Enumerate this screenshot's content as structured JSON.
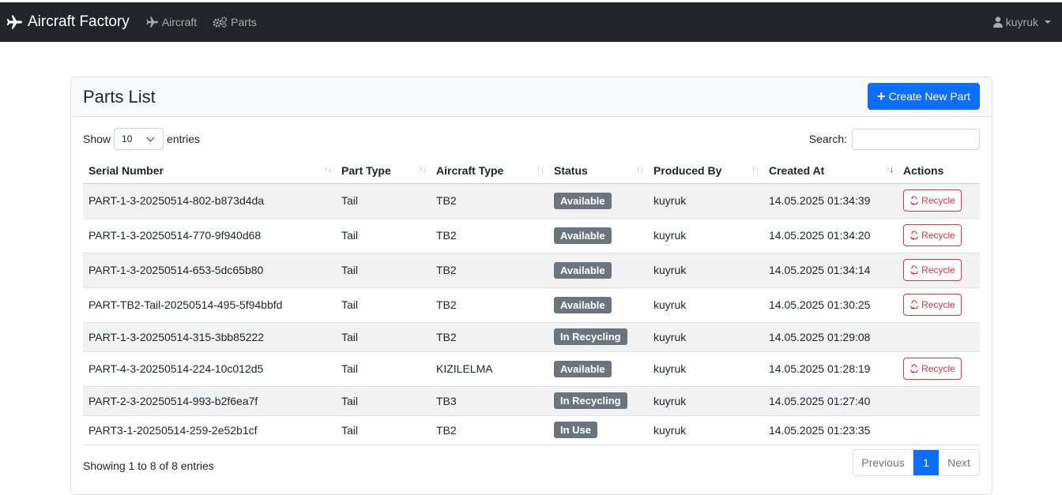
{
  "navbar": {
    "brand": "Aircraft Factory",
    "links": [
      {
        "label": "Aircraft",
        "icon": "plane-icon"
      },
      {
        "label": "Parts",
        "icon": "cogs-icon"
      }
    ],
    "user": "kuyruk"
  },
  "card": {
    "title": "Parts List",
    "create_button": "Create New Part"
  },
  "controls": {
    "show_label": "Show",
    "entries_value": "10",
    "entries_label": "entries",
    "search_label": "Search:",
    "search_value": ""
  },
  "table": {
    "columns": [
      "Serial Number",
      "Part Type",
      "Aircraft Type",
      "Status",
      "Produced By",
      "Created At",
      "Actions"
    ],
    "recycle_label": "Recycle",
    "rows": [
      {
        "serial": "PART-1-3-20250514-802-b873d4da",
        "part_type": "Tail",
        "aircraft": "TB2",
        "status": "Available",
        "by": "kuyruk",
        "created": "14.05.2025 01:34:39",
        "action": true
      },
      {
        "serial": "PART-1-3-20250514-770-9f940d68",
        "part_type": "Tail",
        "aircraft": "TB2",
        "status": "Available",
        "by": "kuyruk",
        "created": "14.05.2025 01:34:20",
        "action": true
      },
      {
        "serial": "PART-1-3-20250514-653-5dc65b80",
        "part_type": "Tail",
        "aircraft": "TB2",
        "status": "Available",
        "by": "kuyruk",
        "created": "14.05.2025 01:34:14",
        "action": true
      },
      {
        "serial": "PART-TB2-Tail-20250514-495-5f94bbfd",
        "part_type": "Tail",
        "aircraft": "TB2",
        "status": "Available",
        "by": "kuyruk",
        "created": "14.05.2025 01:30:25",
        "action": true
      },
      {
        "serial": "PART-1-3-20250514-315-3bb85222",
        "part_type": "Tail",
        "aircraft": "TB2",
        "status": "In Recycling",
        "by": "kuyruk",
        "created": "14.05.2025 01:29:08",
        "action": false
      },
      {
        "serial": "PART-4-3-20250514-224-10c012d5",
        "part_type": "Tail",
        "aircraft": "KIZILELMA",
        "status": "Available",
        "by": "kuyruk",
        "created": "14.05.2025 01:28:19",
        "action": true
      },
      {
        "serial": "PART-2-3-20250514-993-b2f6ea7f",
        "part_type": "Tail",
        "aircraft": "TB3",
        "status": "In Recycling",
        "by": "kuyruk",
        "created": "14.05.2025 01:27:40",
        "action": false
      },
      {
        "serial": "PART3-1-20250514-259-2e52b1cf",
        "part_type": "Tail",
        "aircraft": "TB2",
        "status": "In Use",
        "by": "kuyruk",
        "created": "14.05.2025 01:23:35",
        "action": false
      }
    ]
  },
  "footer": {
    "info": "Showing 1 to 8 of 8 entries",
    "previous": "Previous",
    "page": "1",
    "next": "Next"
  },
  "colors": {
    "navbar": "#212529",
    "primary": "#0d6efd",
    "danger": "#dc3545",
    "badge": "#6c757d"
  }
}
